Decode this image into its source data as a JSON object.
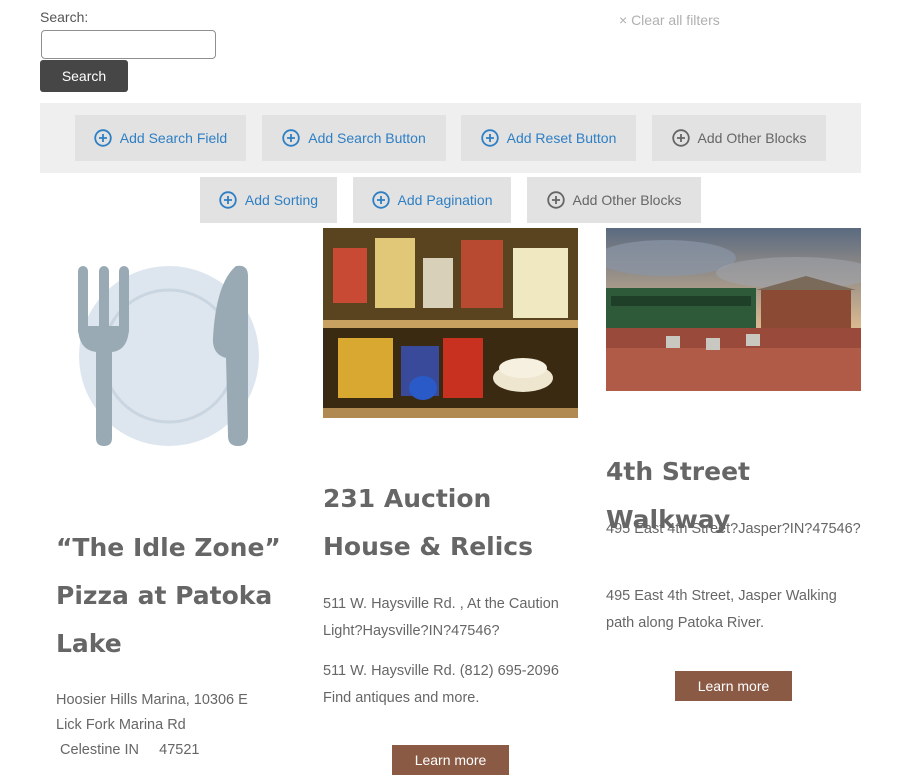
{
  "search": {
    "label": "Search:",
    "value": "",
    "placeholder": "",
    "button_label": "Search",
    "clear_filters": "× Clear all filters"
  },
  "blocks": {
    "row1": [
      {
        "label": "Add Search Field",
        "style": "blue"
      },
      {
        "label": "Add Search Button",
        "style": "blue"
      },
      {
        "label": "Add Reset Button",
        "style": "blue"
      },
      {
        "label": "Add Other Blocks",
        "style": "grey"
      }
    ],
    "row2": [
      {
        "label": "Add Sorting",
        "style": "blue"
      },
      {
        "label": "Add Pagination",
        "style": "blue"
      },
      {
        "label": "Add Other Blocks",
        "style": "grey"
      }
    ]
  },
  "cards": [
    {
      "image": "fork-knife-plate-icon",
      "title": "“The Idle Zone” Pizza at Patoka Lake",
      "address_lines": [
        "Hoosier Hills Marina, 10306 E",
        "Lick Fork Marina Rd",
        " Celestine IN     47521"
      ]
    },
    {
      "image": "antique-shelf-photo",
      "title": "231 Auction House & Relics",
      "paragraphs": [
        "511 W. Haysville Rd. , At the Caution Light?Haysville?IN?47546?",
        "511 W. Haysville Rd. (812) 695-2096 Find antiques and more."
      ],
      "button": "Learn more"
    },
    {
      "image": "train-depot-photo",
      "title": "4th Street Walkway",
      "paragraphs": [
        "495 East 4th Street?Jasper?IN?47546?",
        "495 East 4th Street, Jasper Walking path along Patoka River."
      ],
      "button": "Learn more"
    }
  ],
  "colors": {
    "accent_blue": "#2e7fc4",
    "button_brown": "#8a5a44",
    "search_button": "#464646",
    "bar_background": "#efefef"
  }
}
